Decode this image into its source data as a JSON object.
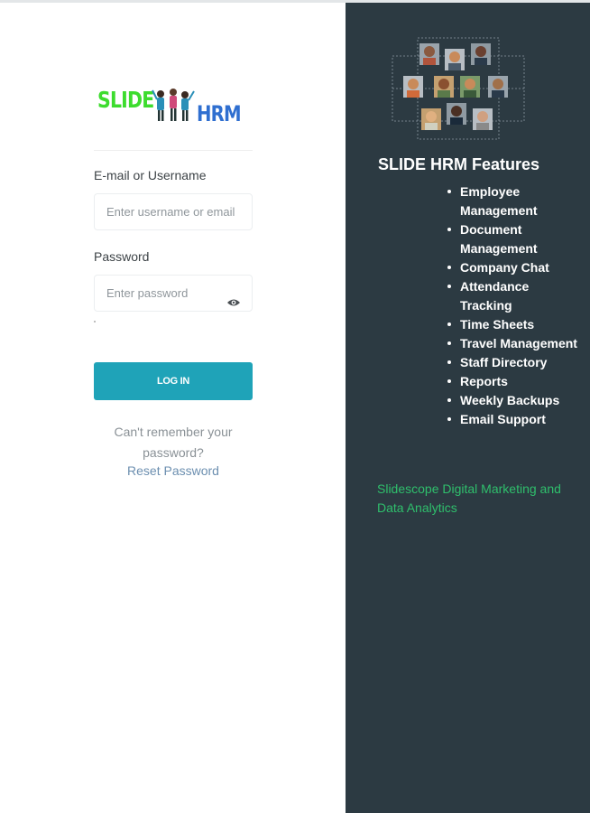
{
  "login": {
    "logo": {
      "word1": "SLIDE",
      "word2": "HRM",
      "color1": "#3ddc2e",
      "color2": "#2f6fd0"
    },
    "username_label": "E-mail or Username",
    "username_placeholder": "Enter username or email",
    "password_label": "Password",
    "password_placeholder": "Enter password",
    "password_toggle_icon": "eye-icon",
    "login_button": "LOG IN",
    "forgot_line1": "Can't remember your",
    "forgot_line2": "password?",
    "reset_link": "Reset Password",
    "accent": "#1fa3b8"
  },
  "features": {
    "graphic_icon": "team-avatars-graphic",
    "title": "SLIDE HRM Features",
    "items": [
      "Employee Management",
      "Document Management",
      "Company Chat",
      "Attendance Tracking",
      "Time Sheets",
      "Travel Management",
      "Staff Directory",
      "Reports",
      "Weekly Backups",
      "Email Support"
    ],
    "company": "Slidescope Digital Marketing and Data Analytics",
    "panel_color": "#2c3a42",
    "company_color": "#2fbf6c"
  }
}
